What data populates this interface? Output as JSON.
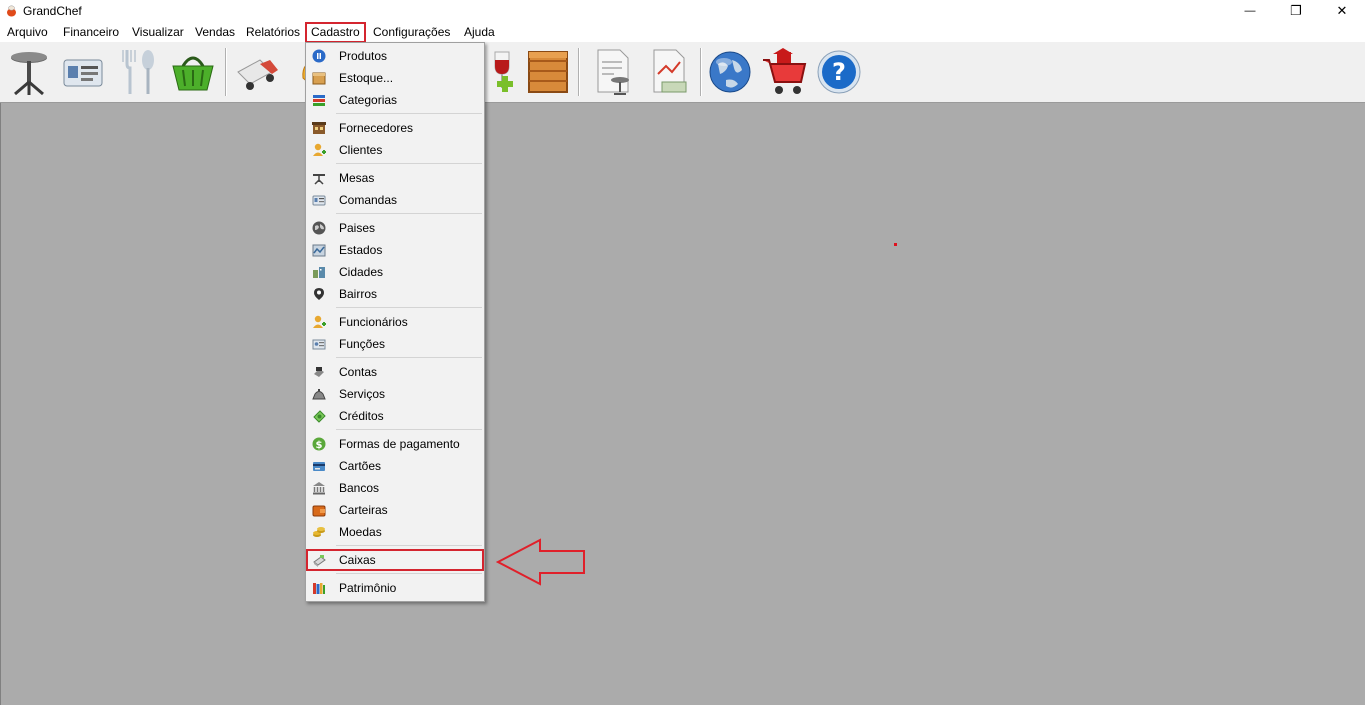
{
  "window": {
    "title": "GrandChef",
    "minimize_glyph": "—",
    "restore_glyph": "❐",
    "close_glyph": "✕"
  },
  "menubar": {
    "items": [
      {
        "label": "Arquivo",
        "id": "arquivo"
      },
      {
        "label": "Financeiro",
        "id": "financeiro"
      },
      {
        "label": "Visualizar",
        "id": "visualizar"
      },
      {
        "label": "Vendas",
        "id": "vendas"
      },
      {
        "label": "Relatórios",
        "id": "relatorios"
      },
      {
        "label": "Cadastro",
        "id": "cadastro",
        "open": true
      },
      {
        "label": "Configurações",
        "id": "configuracoes"
      },
      {
        "label": "Ajuda",
        "id": "ajuda"
      }
    ]
  },
  "toolbar": {
    "buttons": [
      {
        "icon": "table-icon"
      },
      {
        "icon": "order-cards-icon"
      },
      {
        "icon": "cutlery-icon"
      },
      {
        "icon": "basket-icon"
      },
      {
        "icon": "delivery-truck-icon"
      },
      {
        "icon": "pizza-icon"
      },
      {
        "icon": "wine-add-icon"
      },
      {
        "icon": "crate-icon"
      },
      {
        "icon": "report-table-icon"
      },
      {
        "icon": "report-money-icon"
      },
      {
        "icon": "globe-icon"
      },
      {
        "icon": "shopping-cart-icon"
      },
      {
        "icon": "help-icon"
      }
    ]
  },
  "cadastro_menu": {
    "groups": [
      [
        {
          "label": "Produtos",
          "icon": "produtos-icon"
        },
        {
          "label": "Estoque...",
          "icon": "estoque-icon"
        },
        {
          "label": "Categorias",
          "icon": "categorias-icon"
        }
      ],
      [
        {
          "label": "Fornecedores",
          "icon": "fornecedores-icon"
        },
        {
          "label": "Clientes",
          "icon": "clientes-icon"
        }
      ],
      [
        {
          "label": "Mesas",
          "icon": "mesas-icon"
        },
        {
          "label": "Comandas",
          "icon": "comandas-icon"
        }
      ],
      [
        {
          "label": "Paises",
          "icon": "paises-icon"
        },
        {
          "label": "Estados",
          "icon": "estados-icon"
        },
        {
          "label": "Cidades",
          "icon": "cidades-icon"
        },
        {
          "label": "Bairros",
          "icon": "bairros-icon"
        }
      ],
      [
        {
          "label": "Funcionários",
          "icon": "funcionarios-icon"
        },
        {
          "label": "Funções",
          "icon": "funcoes-icon"
        }
      ],
      [
        {
          "label": "Contas",
          "icon": "contas-icon"
        },
        {
          "label": "Serviços",
          "icon": "servicos-icon"
        },
        {
          "label": "Créditos",
          "icon": "creditos-icon"
        }
      ],
      [
        {
          "label": "Formas de pagamento",
          "icon": "formas-pagamento-icon"
        },
        {
          "label": "Cartões",
          "icon": "cartoes-icon"
        },
        {
          "label": "Bancos",
          "icon": "bancos-icon"
        },
        {
          "label": "Carteiras",
          "icon": "carteiras-icon"
        },
        {
          "label": "Moedas",
          "icon": "moedas-icon"
        }
      ],
      [
        {
          "label": "Caixas",
          "icon": "caixas-icon",
          "highlighted": true
        }
      ],
      [
        {
          "label": "Patrimônio",
          "icon": "patrimonio-icon"
        }
      ]
    ]
  },
  "colors": {
    "highlight_red": "#d4252f",
    "workspace_bg": "#ababab"
  }
}
